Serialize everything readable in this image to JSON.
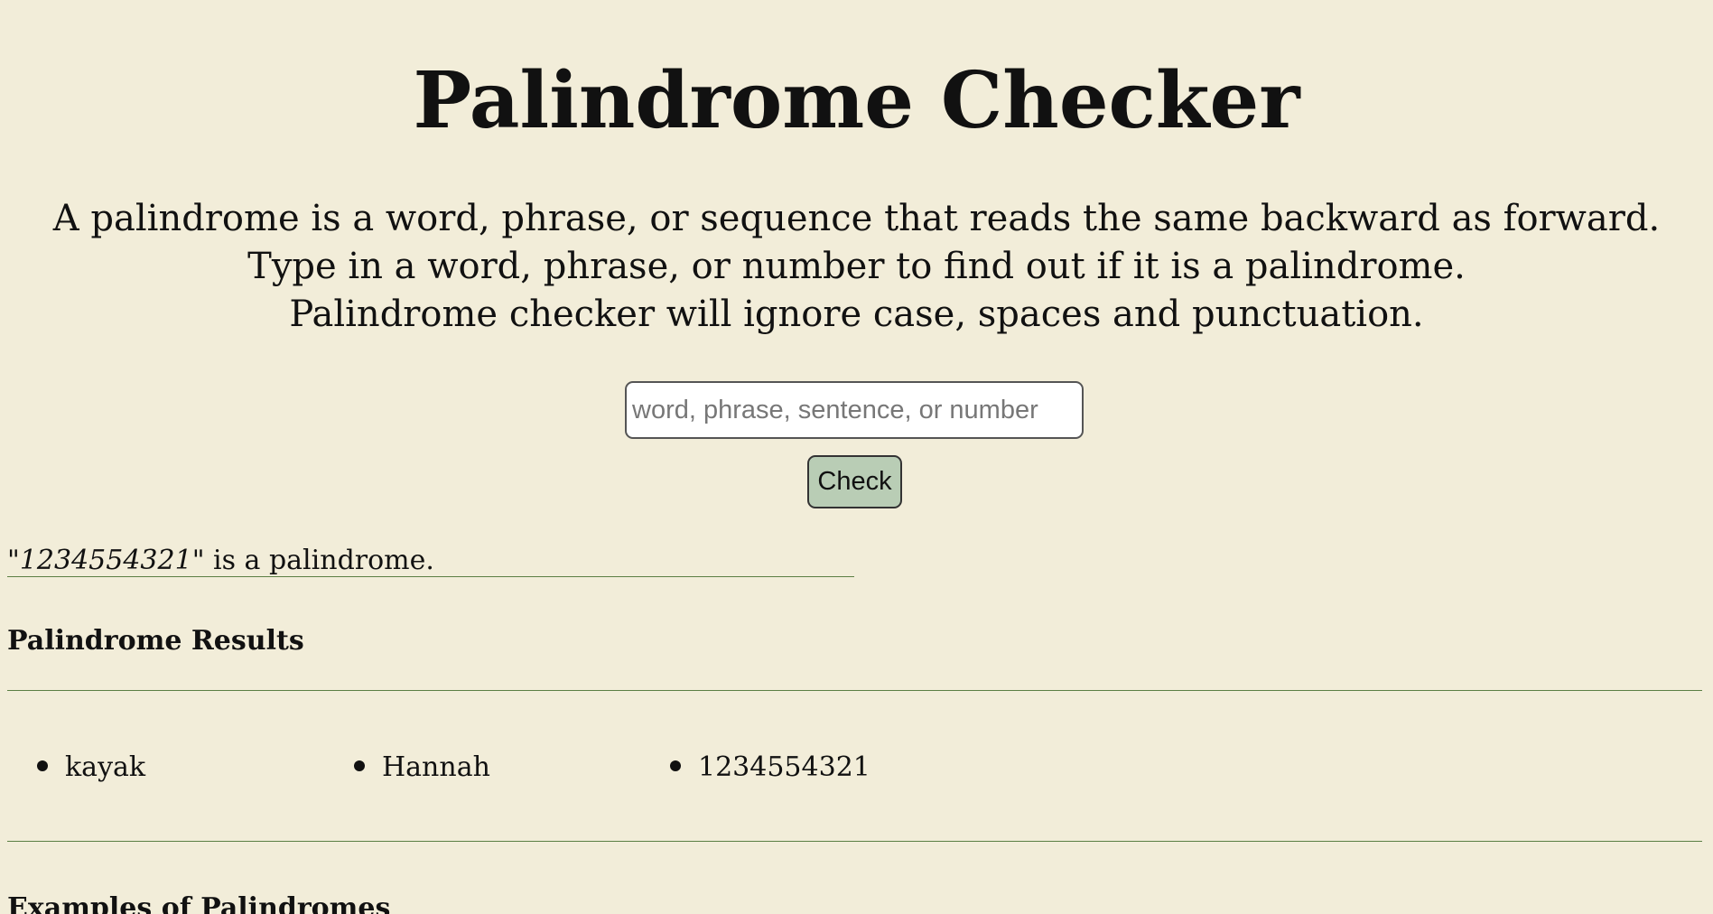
{
  "page": {
    "title": "Palindrome Checker",
    "intro_lines": [
      "A palindrome is a word, phrase, or sequence that reads the same backward as forward.",
      "Type in a word, phrase, or number to find out if it is a palindrome.",
      "Palindrome checker will ignore case, spaces and punctuation."
    ]
  },
  "form": {
    "input_value": "",
    "input_placeholder": "word, phrase, sentence, or number",
    "check_label": "Check"
  },
  "result": {
    "open_quote": "\"",
    "term": "1234554321",
    "close_text": "\" is a palindrome."
  },
  "results_section": {
    "title": "Palindrome Results",
    "items": [
      "kayak",
      "Hannah",
      "1234554321"
    ]
  },
  "examples_section": {
    "title": "Examples of Palindromes"
  },
  "colors": {
    "background": "#f2edd9",
    "button": "#b9cdb5",
    "divider": "#5b7f44"
  }
}
